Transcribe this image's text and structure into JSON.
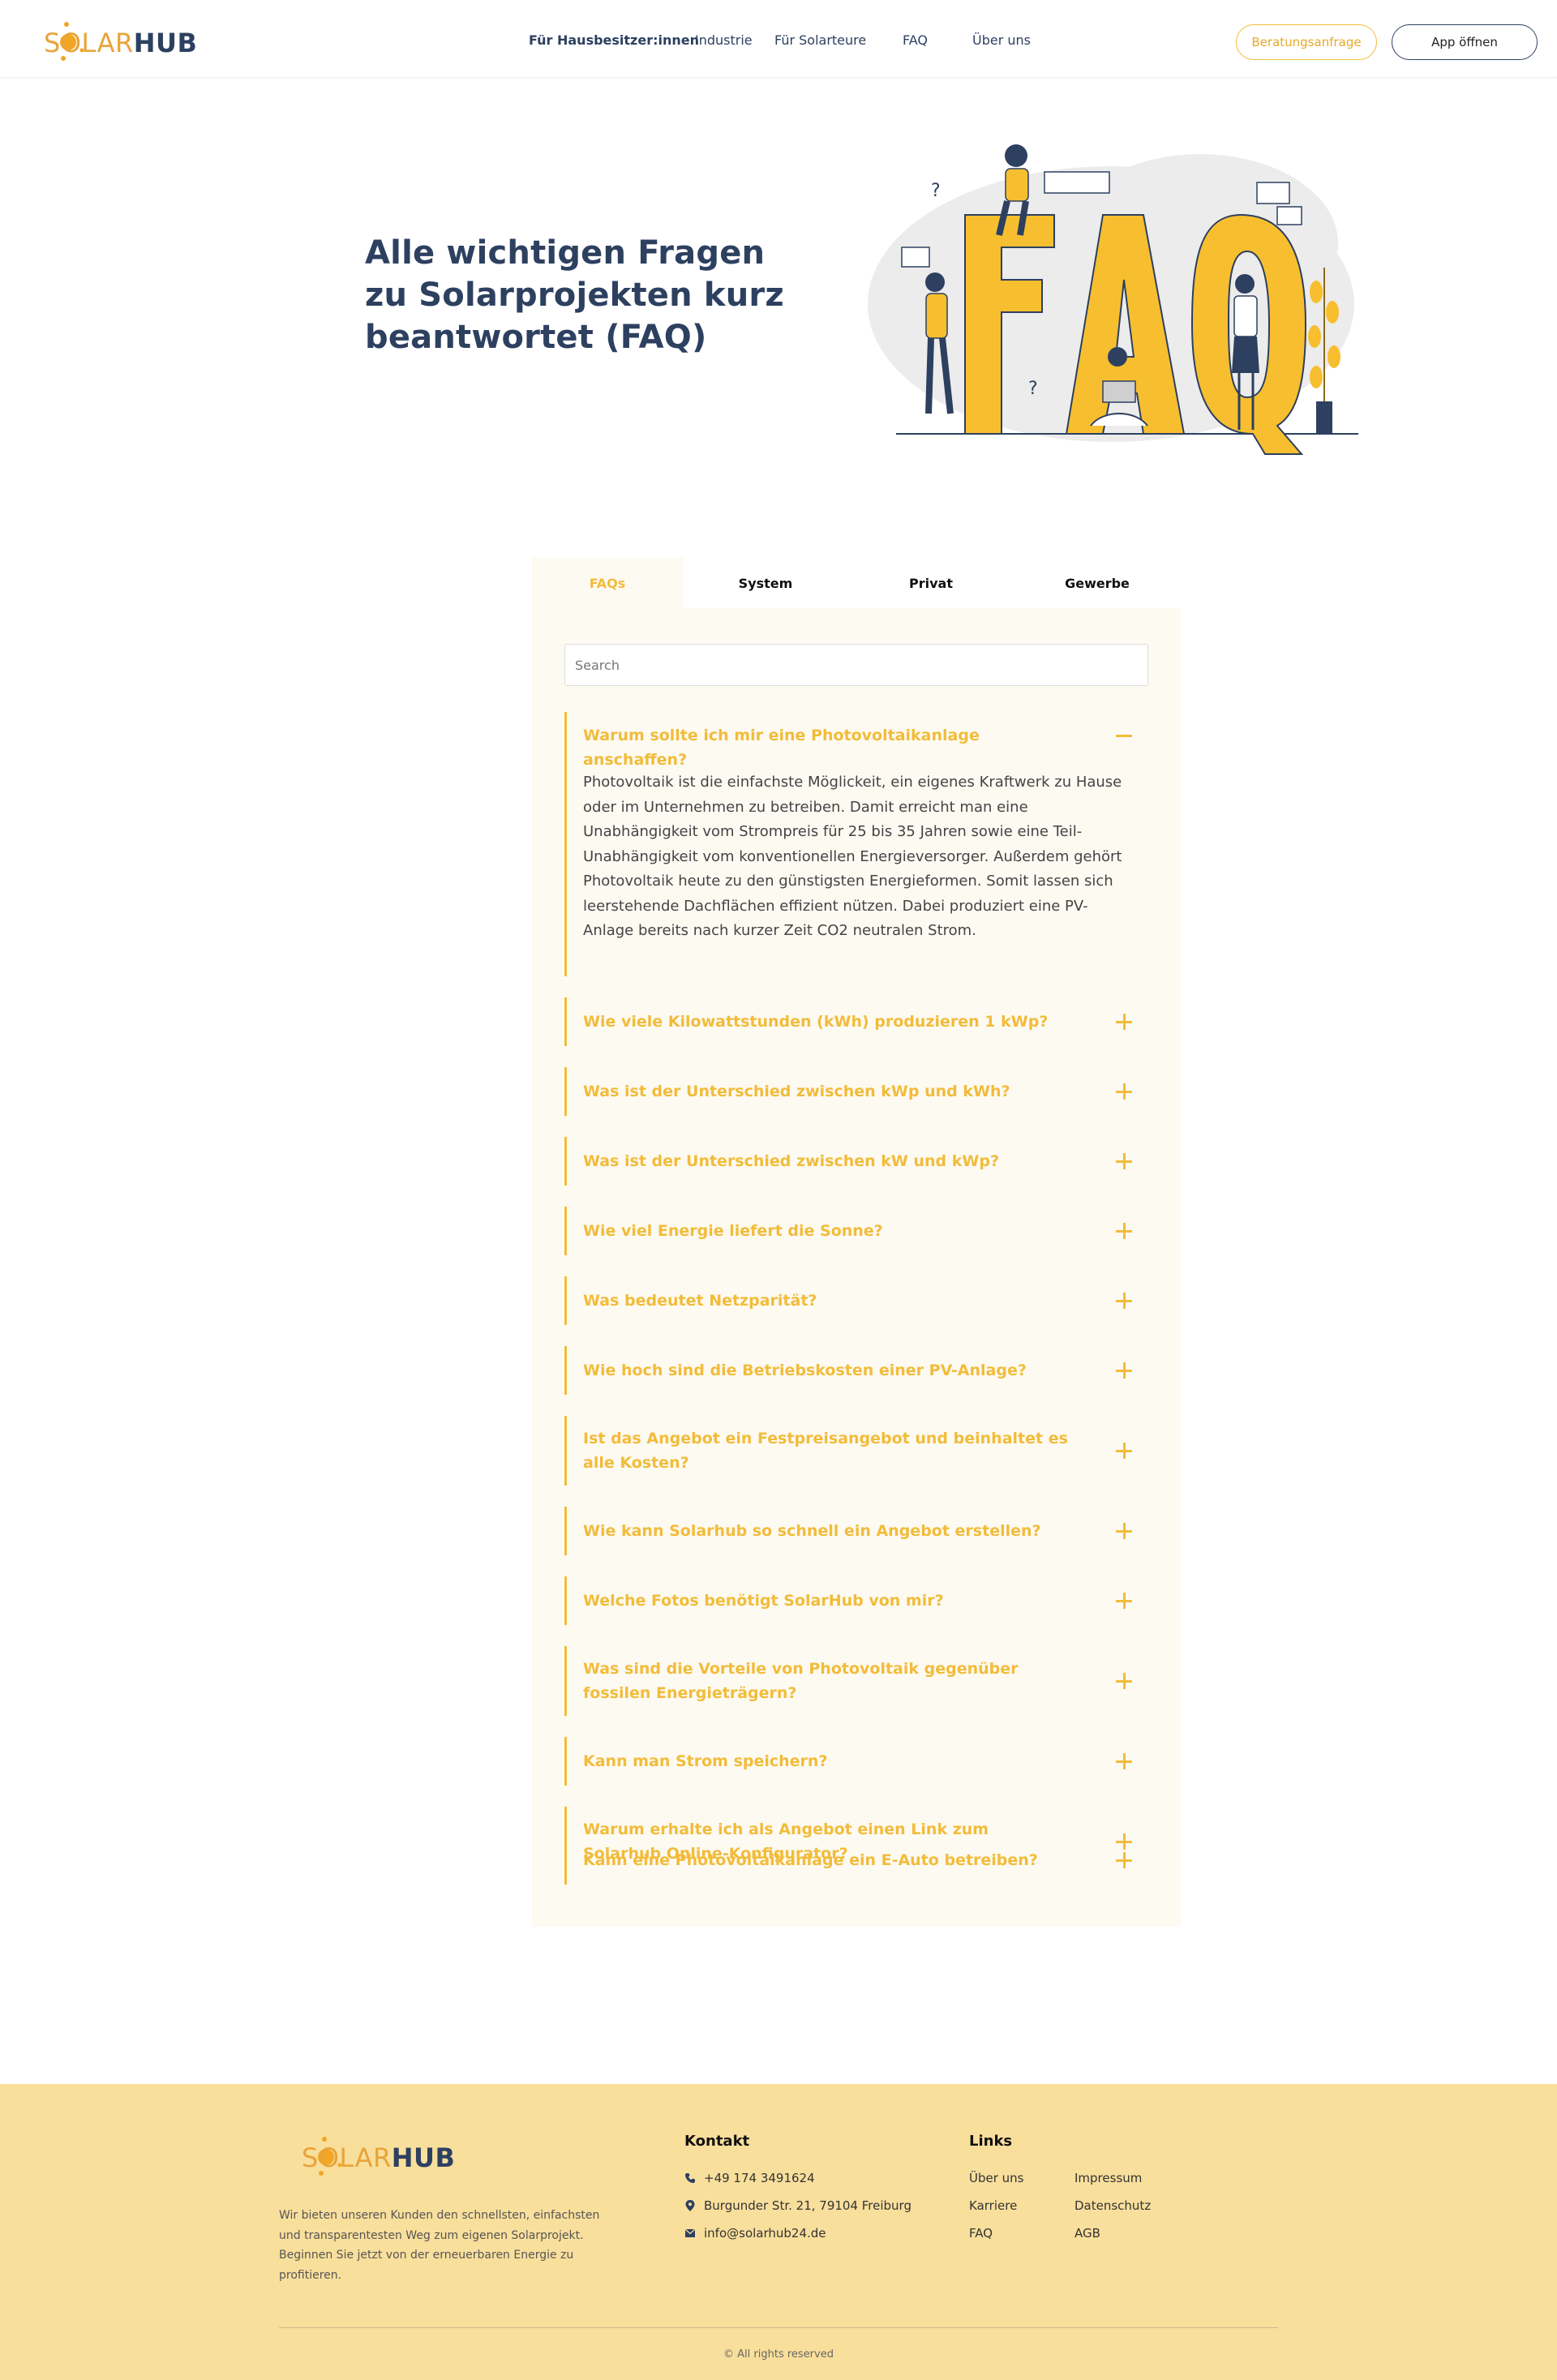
{
  "brand": {
    "logo_solar": "SOLAR",
    "logo_hub": "HUB",
    "accent": "#f2bc3a",
    "navy": "#2d4060",
    "footer_bg": "#f9df9c"
  },
  "nav": {
    "items": [
      {
        "label": "Für Hausbesitzer:innen",
        "active": true
      },
      {
        "label": "Industrie"
      },
      {
        "label": "Für Solarteure"
      },
      {
        "label": "FAQ"
      },
      {
        "label": "Über uns"
      }
    ],
    "consult_button": "Beratungsanfrage",
    "app_button": "App öffnen"
  },
  "hero": {
    "title": "Alle wichtigen Fragen zu Solarprojekten kurz beantwortet (FAQ)",
    "illustration_text": "FAQ"
  },
  "tabs": [
    {
      "label": "FAQs",
      "active": true
    },
    {
      "label": "System"
    },
    {
      "label": "Privat"
    },
    {
      "label": "Gewerbe"
    }
  ],
  "search": {
    "placeholder": "Search",
    "value": ""
  },
  "faq": {
    "items": [
      {
        "question": "Warum sollte ich mir eine Photovoltaikanlage anschaffen?",
        "expanded": true,
        "answer": "Photovoltaik ist die einfachste Möglickeit, ein eigenes Kraftwerk zu Hause oder im Unternehmen zu betreiben. Damit erreicht man eine Unabhängigkeit vom Strompreis für 25 bis 35 Jahren sowie eine Teil-Unabhängigkeit vom konventionellen Energieversorger. Außerdem gehört Photovoltaik heute zu den günstigsten Energieformen. Somit lassen sich leerstehende Dachflächen effizient nützen. Dabei produziert eine PV-Anlage bereits nach kurzer Zeit CO2 neutralen Strom."
      },
      {
        "question": "Wie viele Kilowattstunden (kWh) produzieren 1 kWp?"
      },
      {
        "question": "Was ist der Unterschied zwischen kWp und kWh?"
      },
      {
        "question": "Was ist der Unterschied zwischen kW und kWp?"
      },
      {
        "question": "Wie viel Energie liefert die Sonne?"
      },
      {
        "question": "Was bedeutet Netzparität?"
      },
      {
        "question": "Wie hoch sind die Betriebskosten einer PV-Anlage?"
      },
      {
        "question": "Ist das Angebot ein Festpreisangebot und beinhaltet es alle Kosten?"
      },
      {
        "question": "Wie kann Solarhub so schnell ein Angebot erstellen?"
      },
      {
        "question": "Welche Fotos benötigt SolarHub von mir?"
      },
      {
        "question": "Was sind die Vorteile von Photovoltaik gegenüber fossilen Energieträgern?"
      },
      {
        "question": "Kann man Strom speichern?"
      },
      {
        "question": "Warum erhalte ich als Angebot einen Link zum Solarhub Online-Konfigurator?"
      },
      {
        "question": "Kann eine Photovoltaikanlage ein E-Auto betreiben?"
      }
    ]
  },
  "footer": {
    "description": "Wir bieten unseren Kunden den schnellsten, einfachsten und transparentesten Weg zum eigenen Solarprojekt. Beginnen Sie jetzt von der erneuerbaren Energie zu profitieren.",
    "contact_heading": "Kontakt",
    "phone": "+49 174 3491624",
    "address": "Burgunder Str. 21, 79104 Freiburg",
    "email": "info@solarhub24.de",
    "links_heading": "Links",
    "links_col1": [
      "Über uns",
      "Karriere",
      "FAQ"
    ],
    "links_col2": [
      "Impressum",
      "Datenschutz",
      "AGB"
    ],
    "copyright": "© All rights reserved"
  }
}
